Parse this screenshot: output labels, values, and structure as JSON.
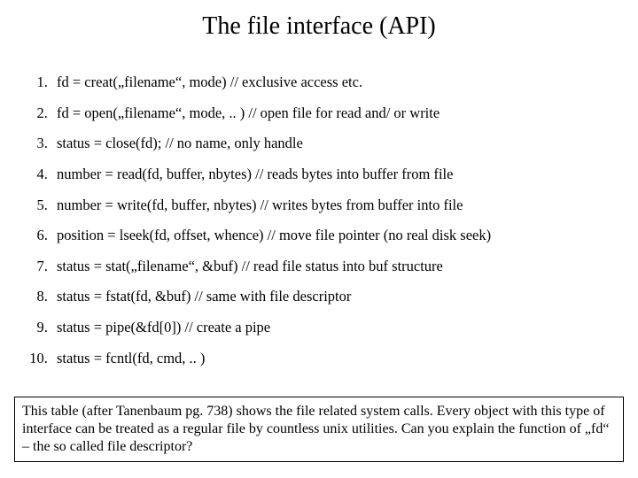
{
  "title": "The file interface (API)",
  "items": [
    "fd = creat(„filename“, mode)  // exclusive access etc.",
    "fd = open(„filename“, mode, .. ) // open file for read and/ or write",
    "status = close(fd); // no name, only handle",
    "number = read(fd, buffer, nbytes) // reads bytes into buffer from file",
    "number = write(fd, buffer, nbytes) // writes bytes from buffer into file",
    "position = lseek(fd, offset, whence) // move file pointer (no real disk seek)",
    "status = stat(„filename“, &buf) // read file status into buf structure",
    "status = fstat(fd, &buf) // same with file descriptor",
    "status = pipe(&fd[0]) // create a pipe",
    "status = fcntl(fd, cmd, .. )"
  ],
  "footnote": "This table (after Tanenbaum pg. 738) shows the file related system calls. Every object with this type of interface can be treated as a regular file by countless unix utilities. Can you explain the function of „fd“ – the so called file descriptor?"
}
